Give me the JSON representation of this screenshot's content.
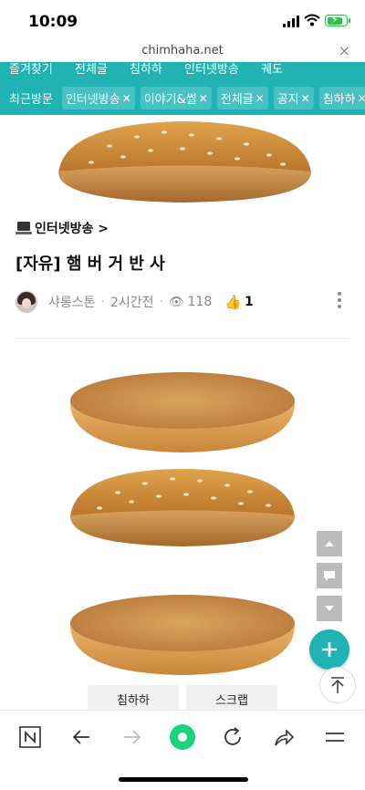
{
  "status": {
    "time": "10:09"
  },
  "browser": {
    "url": "chimhaha.net",
    "close_label": "×"
  },
  "nav": {
    "row1": [
      "즐겨찾기",
      "전체글",
      "침하하",
      "인터넷방송",
      "궤도"
    ],
    "recent_label": "최근방문",
    "chips": [
      "인터넷방송",
      "이야기&썰",
      "전체글",
      "공지",
      "침하하"
    ],
    "chip_close": "✕"
  },
  "post": {
    "category": "인터넷방송 >",
    "title": "[자유] 햄 버 거 반 사",
    "author": "샤롱스톤",
    "time": "2시간전",
    "views": "118",
    "likes": "1"
  },
  "actions": {
    "left": "침하하",
    "right": "스크랩"
  },
  "colors": {
    "accent": "#21b3b4",
    "bun_top": "#c98a3a",
    "bun_toast": "#d9a55c"
  },
  "icons": {
    "toolbar": [
      "naver-n-icon",
      "back-arrow-icon",
      "forward-arrow-icon",
      "home-dot-icon",
      "reload-icon",
      "share-icon",
      "menu-icon"
    ]
  }
}
